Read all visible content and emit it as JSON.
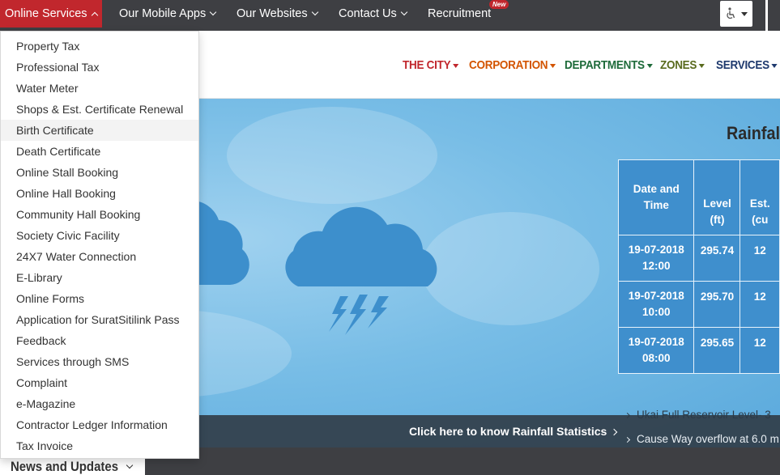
{
  "topbar": {
    "items": [
      {
        "label": "Online Services"
      },
      {
        "label": "Our Mobile Apps"
      },
      {
        "label": "Our Websites"
      },
      {
        "label": "Contact Us"
      },
      {
        "label": "Recruitment"
      }
    ],
    "new_badge": "New",
    "accessibility_icon": "wheelchair-icon"
  },
  "main_nav": [
    {
      "label": "THE CITY",
      "color": "#c1272d"
    },
    {
      "label": "CORPORATION",
      "color": "#d35400"
    },
    {
      "label": "DEPARTMENTS",
      "color": "#1e6b3a"
    },
    {
      "label": "ZONES",
      "color": "#5a6b1e"
    },
    {
      "label": "SERVICES",
      "color": "#1f3a6e"
    }
  ],
  "online_services_menu": [
    "Property Tax",
    "Professional Tax",
    "Water Meter",
    "Shops & Est. Certificate Renewal",
    "Birth Certificate",
    "Death Certificate",
    "Online Stall Booking",
    "Online Hall Booking",
    "Community Hall Booking",
    "Society Civic Facility",
    "24X7 Water Connection",
    "E-Library",
    "Online Forms",
    "Application for SuratSitilink Pass",
    "Feedback",
    "Services through SMS",
    "Complaint",
    "e-Magazine",
    "Contractor Ledger Information",
    "Tax Invoice"
  ],
  "hero": {
    "rain_title": "Rainfal",
    "table_headers": {
      "date": "Date and Time",
      "level": "Level (ft)",
      "est": "Est. (cu"
    },
    "rows": [
      {
        "date": "19-07-2018 12:00",
        "level": "295.74",
        "est": "12"
      },
      {
        "date": "19-07-2018 10:00",
        "level": "295.70",
        "est": "12"
      },
      {
        "date": "19-07-2018 08:00",
        "level": "295.65",
        "est": "12"
      }
    ],
    "stats_link": "Click here to know Rainfall Statistics",
    "ticker": [
      "Ukai Full Reservoir Level- 3",
      "Cause Way overflow at 6.0 m"
    ]
  },
  "news": {
    "label": "News and Updates"
  },
  "colors": {
    "topbar_bg": "#3e3f43",
    "accent_red": "#c1272d",
    "table_blue": "#3f8fcd",
    "cloud_blue": "#3d8fcc"
  }
}
